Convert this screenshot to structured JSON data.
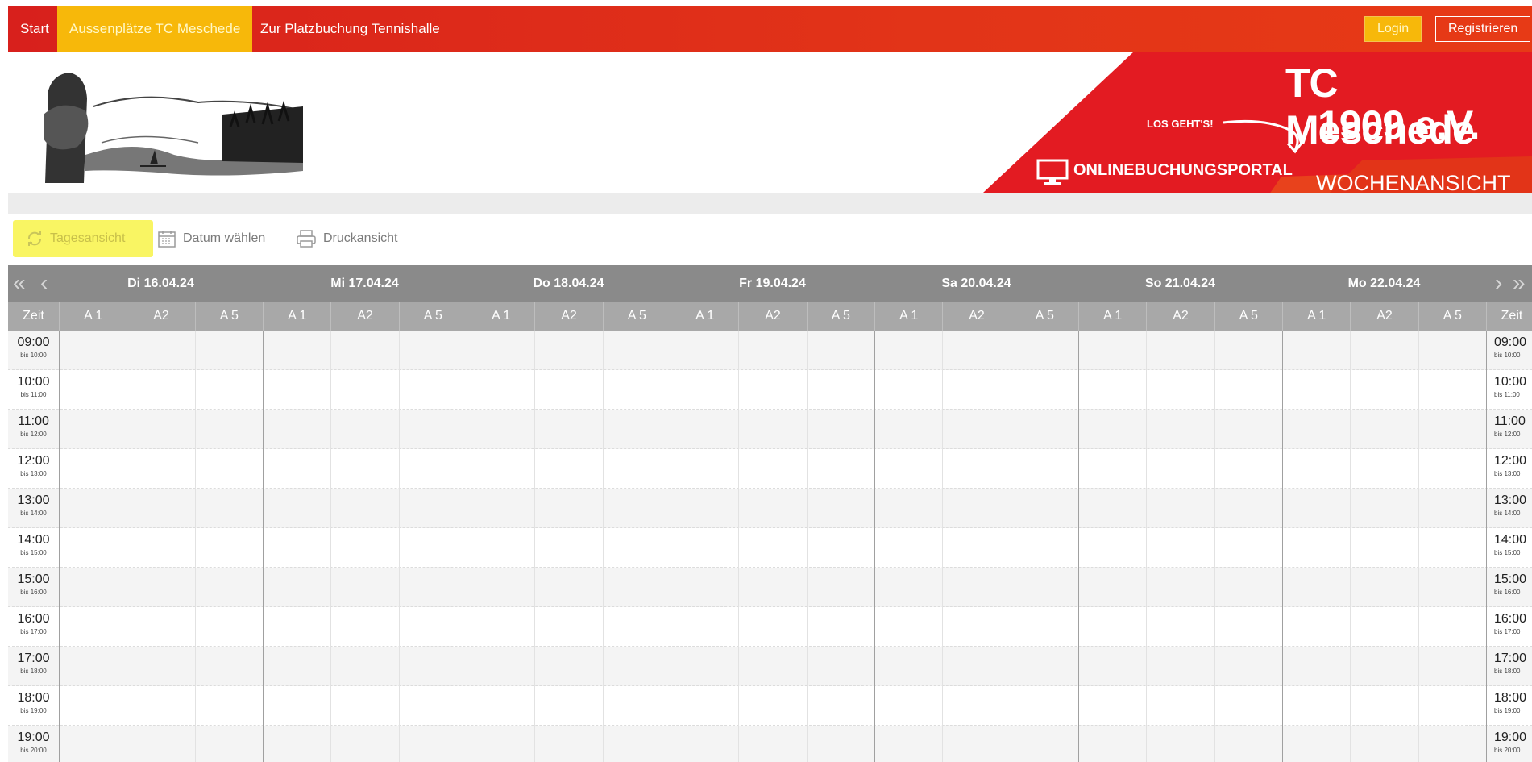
{
  "nav": {
    "start": "Start",
    "aussenplaetze": "Aussenplätze TC Meschede",
    "platzbuchung": "Zur Platzbuchung Tennishalle",
    "login": "Login",
    "registrieren": "Registrieren"
  },
  "promo": {
    "los_gehts": "LOS GEHT'S!",
    "portal": "ONLINEBUCHUNGSPORTAL",
    "club_line1": "TC Meschede",
    "club_line2": "1909 e.V.",
    "view": "WOCHENANSICHT"
  },
  "toolbar": {
    "tagesansicht": "Tagesansicht",
    "datum": "Datum wählen",
    "druck": "Druckansicht"
  },
  "calendar": {
    "zeit_label": "Zeit",
    "days": [
      "Di 16.04.24",
      "Mi 17.04.24",
      "Do 18.04.24",
      "Fr 19.04.24",
      "Sa 20.04.24",
      "So 21.04.24",
      "Mo 22.04.24"
    ],
    "courts": [
      "A 1",
      "A2",
      "A 5"
    ],
    "rows": [
      {
        "time": "09:00",
        "until": "bis 10:00"
      },
      {
        "time": "10:00",
        "until": "bis 11:00"
      },
      {
        "time": "11:00",
        "until": "bis 12:00"
      },
      {
        "time": "12:00",
        "until": "bis 13:00"
      },
      {
        "time": "13:00",
        "until": "bis 14:00"
      },
      {
        "time": "14:00",
        "until": "bis 15:00"
      },
      {
        "time": "15:00",
        "until": "bis 16:00"
      },
      {
        "time": "16:00",
        "until": "bis 17:00"
      },
      {
        "time": "17:00",
        "until": "bis 18:00"
      },
      {
        "time": "18:00",
        "until": "bis 19:00"
      },
      {
        "time": "19:00",
        "until": "bis 20:00"
      }
    ]
  },
  "colors": {
    "brand_red": "#e2231a",
    "highlight_yellow": "#f7b80a",
    "header_gray": "#8a8a8a"
  }
}
